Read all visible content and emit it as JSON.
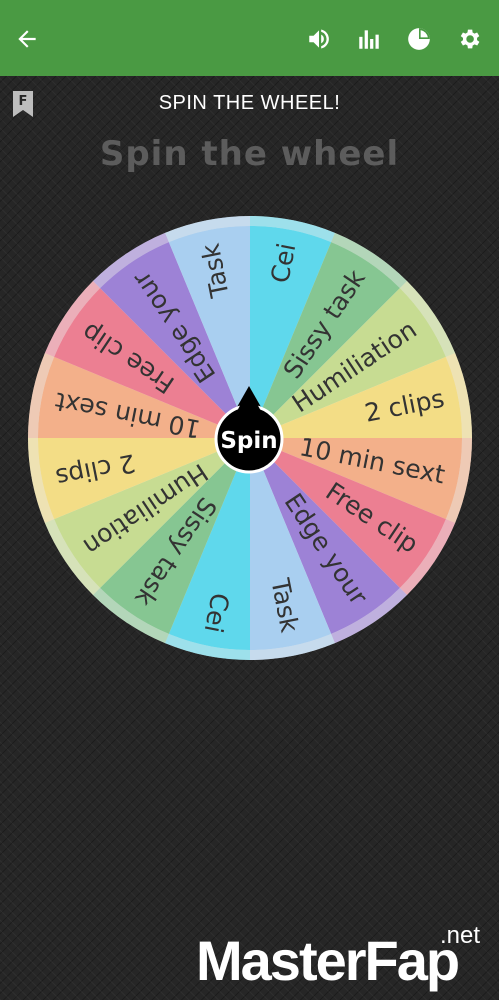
{
  "appbar": {
    "color": "#4a9a43",
    "icons": [
      "back-arrow-icon",
      "volume-icon",
      "stats-icon",
      "pie-chart-icon",
      "settings-gear-icon"
    ]
  },
  "screen": {
    "title": "SPIN THE WHEEL!",
    "subtitle": "Spin the wheel",
    "bookmark_letter": "F"
  },
  "wheel": {
    "spin_label": "Spin",
    "segments": [
      {
        "label": "Cei",
        "color": "#5fd8ec"
      },
      {
        "label": "Sissy task",
        "color": "#86c692"
      },
      {
        "label": "Humiliation",
        "color": "#c7dc92"
      },
      {
        "label": "2 clips",
        "color": "#f3dd86"
      },
      {
        "label": "10 min sext",
        "color": "#f3b08a"
      },
      {
        "label": "Free clip",
        "color": "#ec7f92"
      },
      {
        "label": "Edge your",
        "color": "#9d82d6"
      },
      {
        "label": "Task",
        "color": "#a9cff0"
      },
      {
        "label": "Cei",
        "color": "#5fd8ec"
      },
      {
        "label": "Sissy task",
        "color": "#86c692"
      },
      {
        "label": "Humiliation",
        "color": "#c7dc92"
      },
      {
        "label": "2 clips",
        "color": "#f3dd86"
      },
      {
        "label": "10 min sext",
        "color": "#f3b08a"
      },
      {
        "label": "Free clip",
        "color": "#ec7f92"
      },
      {
        "label": "Edge your",
        "color": "#9d82d6"
      },
      {
        "label": "Task",
        "color": "#a9cff0"
      }
    ]
  },
  "watermark": {
    "main": "MasterFap",
    "suffix": ".net"
  }
}
